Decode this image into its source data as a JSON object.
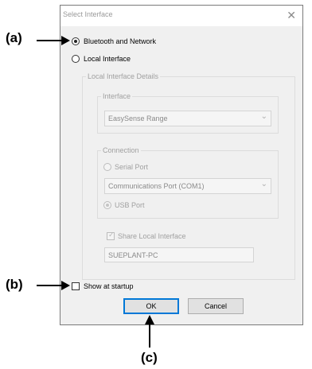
{
  "window": {
    "title": "Select Interface",
    "close_icon": "close-icon"
  },
  "options": {
    "bluetooth_label": "Bluetooth and Network",
    "local_label": "Local Interface",
    "selected": "Bluetooth and Network"
  },
  "details": {
    "group_label": "Local Interface Details",
    "interface_group_label": "Interface",
    "interface_value": "EasySense Range",
    "connection_group_label": "Connection",
    "serial_label": "Serial Port",
    "port_value": "Communications Port (COM1)",
    "usb_label": "USB Port",
    "share_label": "Share Local Interface",
    "share_checked": true,
    "computer_name": "SUEPLANT-PC"
  },
  "footer": {
    "startup_label": "Show at startup",
    "startup_checked": false,
    "ok_label": "OK",
    "cancel_label": "Cancel"
  },
  "callouts": {
    "a": "(a)",
    "b": "(b)",
    "c": "(c)"
  },
  "colors": {
    "dialog_bg": "#f0f0f0",
    "disabled_text": "#a0a0a0",
    "default_button_border": "#0078d7"
  }
}
